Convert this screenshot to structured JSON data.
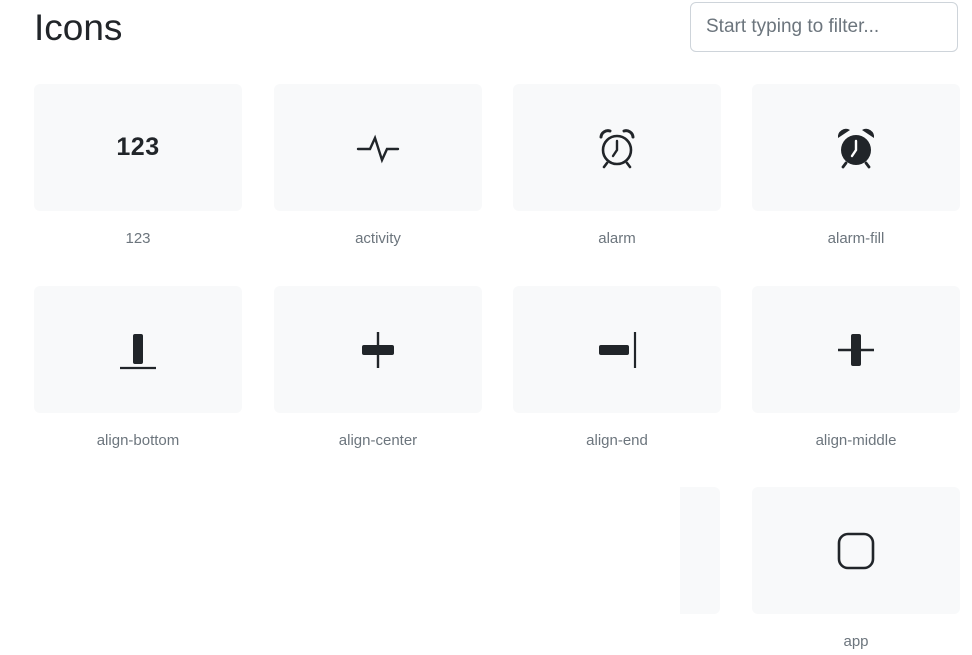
{
  "header": {
    "title": "Icons",
    "filter_placeholder": "Start typing to filter..."
  },
  "icons": [
    {
      "name": "123",
      "icon": "123-icon",
      "glyph_text": "123"
    },
    {
      "name": "activity",
      "icon": "activity-icon"
    },
    {
      "name": "alarm",
      "icon": "alarm-icon"
    },
    {
      "name": "alarm-fill",
      "icon": "alarm-fill-icon"
    },
    {
      "name": "align-bottom",
      "icon": "align-bottom-icon"
    },
    {
      "name": "align-center",
      "icon": "align-center-icon"
    },
    {
      "name": "align-end",
      "icon": "align-end-icon"
    },
    {
      "name": "align-middle",
      "icon": "align-middle-icon"
    },
    {
      "name": "app",
      "icon": "app-icon"
    }
  ],
  "colors": {
    "tile_background": "#f8f9fa",
    "icon": "#212529",
    "label": "#6c757d"
  }
}
